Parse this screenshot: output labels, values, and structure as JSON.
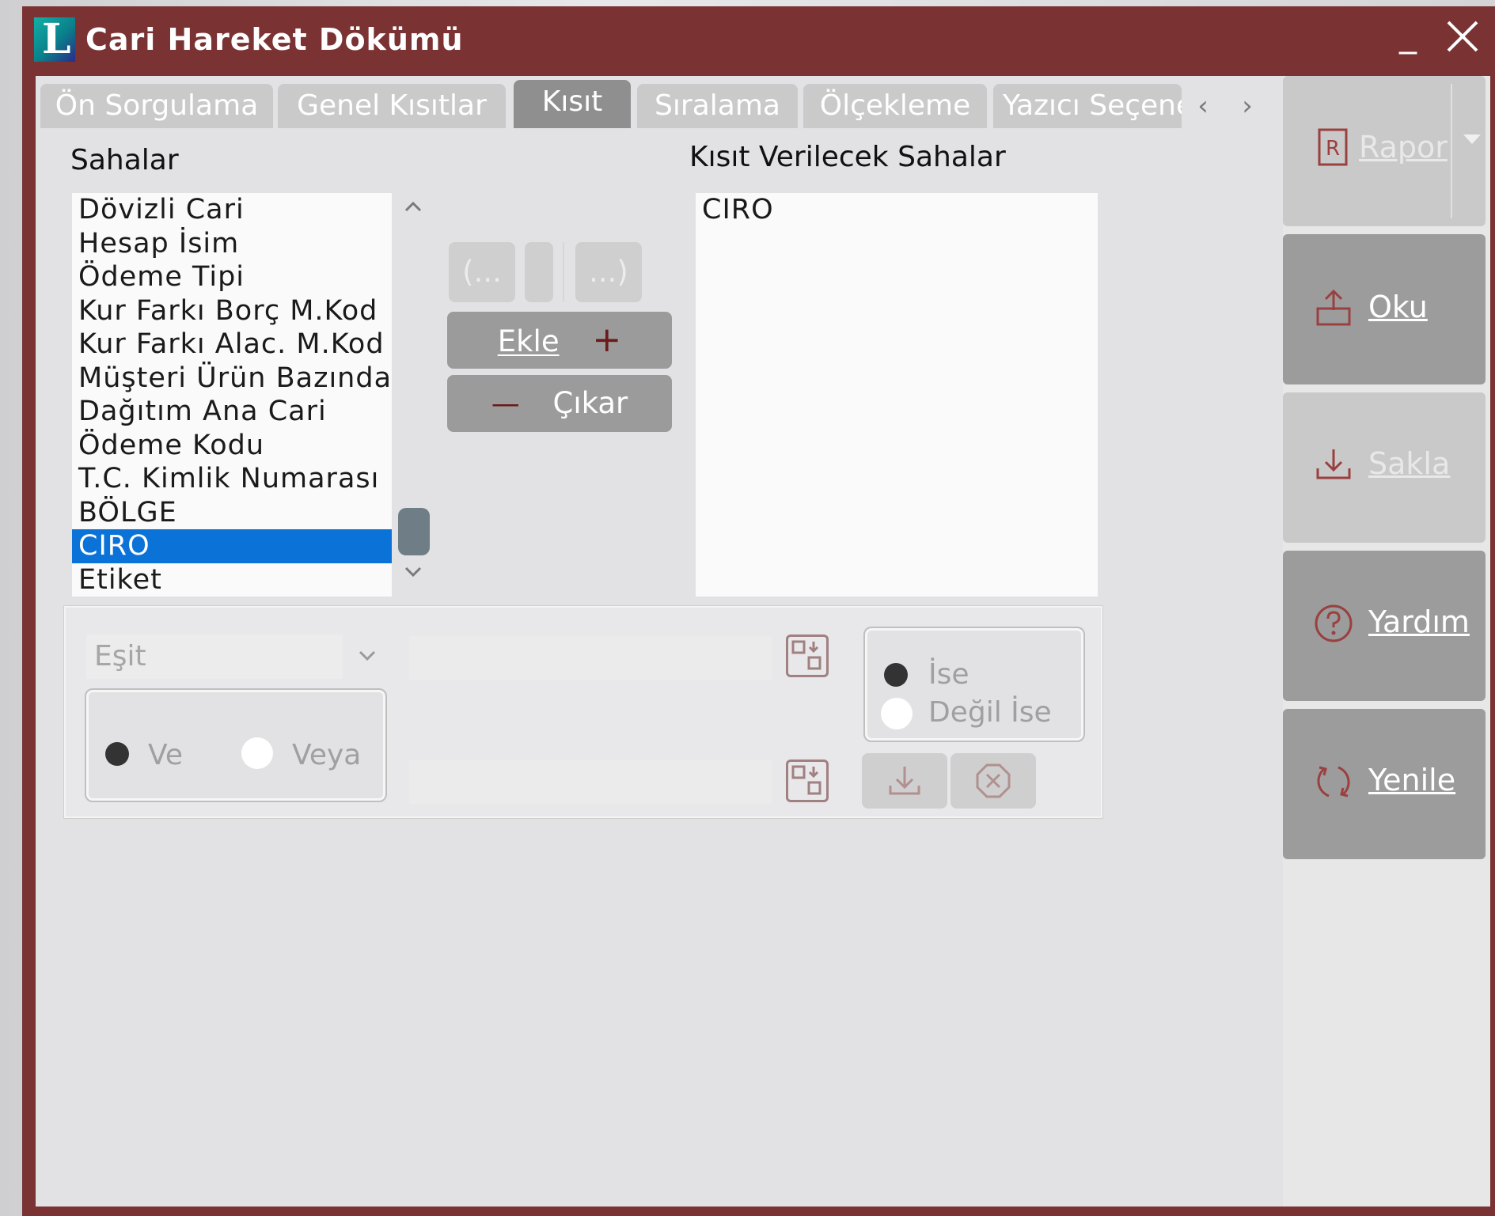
{
  "window": {
    "title": "Cari Hareket Dökümü",
    "logo_letter": "L",
    "minimize_label": "_",
    "close_label": "X"
  },
  "tabs": [
    {
      "label": "Ön Sorgulama",
      "active": false
    },
    {
      "label": "Genel Kısıtlar",
      "active": false
    },
    {
      "label": "Kısıt",
      "active": true
    },
    {
      "label": "Sıralama",
      "active": false
    },
    {
      "label": "Ölçekleme",
      "active": false
    },
    {
      "label": "Yazıcı Seçenekleri",
      "active": false
    }
  ],
  "tab_nav": {
    "prev": "‹",
    "next": "›"
  },
  "fields_panel": {
    "title": "Sahalar",
    "items": [
      "Dövizli Cari",
      "Hesap İsim",
      "Ödeme Tipi",
      "Kur Farkı Borç M.Kod",
      "Kur Farkı Alac. M.Kod",
      "Müşteri Ürün Bazında",
      "Dağıtım Ana Cari",
      "Ödeme Kodu",
      "T.C. Kimlik Numarası",
      "BÖLGE",
      "CIRO",
      "Etiket"
    ],
    "selected": "CIRO"
  },
  "paren_buttons": {
    "open": "(...",
    "mid": "",
    "close": "...)"
  },
  "add_button": {
    "label": "Ekle",
    "icon": "+"
  },
  "remove_button": {
    "label": "Çıkar",
    "icon": "—"
  },
  "target_panel": {
    "title": "Kısıt Verilecek Sahalar",
    "items": [
      "CIRO"
    ]
  },
  "condition": {
    "operator_value": "Eşit",
    "value1": "",
    "value2": "",
    "logic": {
      "and_label": "Ve",
      "or_label": "Veya",
      "selected": "Ve"
    },
    "negation": {
      "is_label": "İse",
      "not_label": "Değil İse",
      "selected": "İse"
    }
  },
  "sidebar": {
    "rapor": "Rapor",
    "oku": "Oku",
    "sakla": "Sakla",
    "yardim": "Yardım",
    "yenile": "Yenile",
    "rapor_icon_letter": "R"
  },
  "colors": {
    "window_frame": "#7a3232",
    "selection": "#0b72d8",
    "button": "#9b9b9b",
    "button_disabled": "#c9c9c9"
  }
}
